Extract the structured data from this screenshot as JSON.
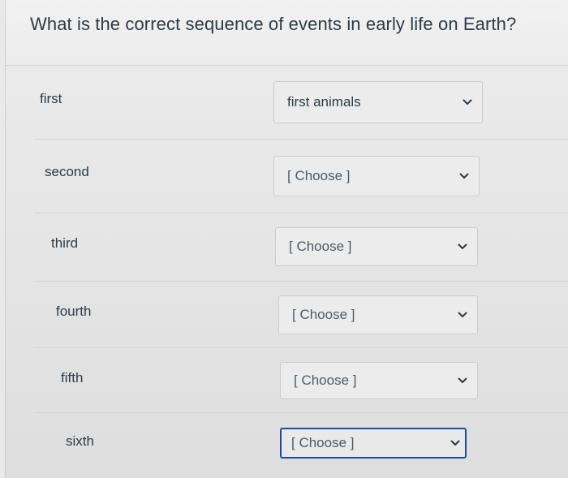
{
  "question": {
    "text": "What is the correct sequence of events in early life on Earth?"
  },
  "rows": [
    {
      "label": "first",
      "value": "first animals",
      "is_placeholder": false
    },
    {
      "label": "second",
      "value": "[ Choose ]",
      "is_placeholder": true
    },
    {
      "label": "third",
      "value": "[ Choose ]",
      "is_placeholder": true
    },
    {
      "label": "fourth",
      "value": "[ Choose ]",
      "is_placeholder": true
    },
    {
      "label": "fifth",
      "value": "[ Choose ]",
      "is_placeholder": true
    },
    {
      "label": "sixth",
      "value": "[ Choose ]",
      "is_placeholder": true
    }
  ],
  "icons": {
    "dropdown": "chevron-down-icon"
  },
  "colors": {
    "text": "#2d3b45",
    "focus_border": "#1b4b9e",
    "select_border": "#c7cdd1"
  }
}
